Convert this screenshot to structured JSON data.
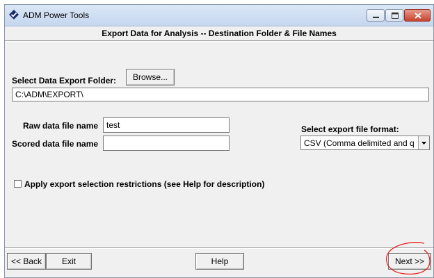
{
  "window": {
    "title": "ADM Power Tools",
    "icon": "checkmark-diamond-icon",
    "controls": {
      "minimize_icon": "minimize-icon",
      "maximize_icon": "maximize-icon",
      "close_icon": "close-icon"
    }
  },
  "dialog": {
    "subtitle": "Export Data for Analysis -- Destination Folder & File Names"
  },
  "export_folder": {
    "label": "Select Data Export Folder:",
    "browse_label": "Browse...",
    "path_value": "C:\\ADM\\EXPORT\\"
  },
  "files": {
    "raw_label": "Raw data file name",
    "raw_value": "test",
    "scored_label": "Scored data file name",
    "scored_value": ""
  },
  "format": {
    "label": "Select export file format:",
    "selected": "CSV (Comma delimited and q"
  },
  "restrictions": {
    "checked": false,
    "label": "Apply export selection restrictions  (see Help for description)"
  },
  "footer": {
    "back_label": "<< Back",
    "exit_label": "Exit",
    "help_label": "Help",
    "next_label": "Next >>"
  },
  "colors": {
    "annotation": "#e8231f",
    "title_bar": "#c5d6ee",
    "close_button": "#c7442e"
  }
}
